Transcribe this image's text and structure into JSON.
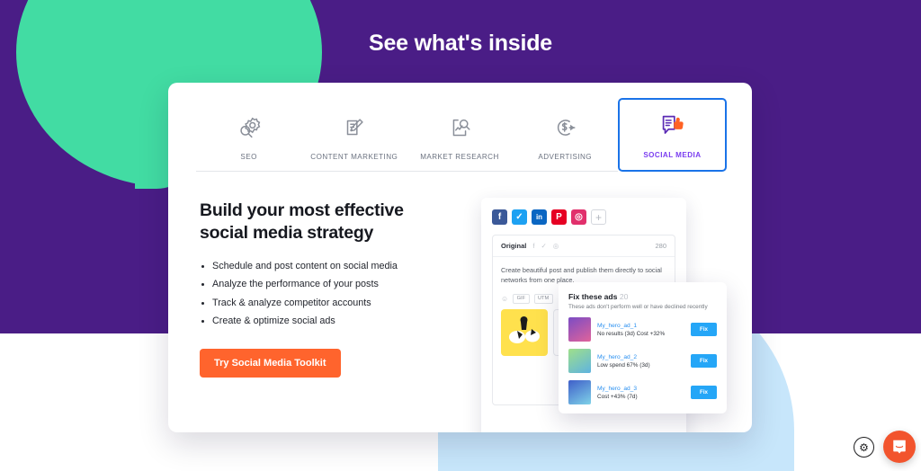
{
  "page": {
    "title": "See what's inside",
    "bg_purple": "#4a1d86",
    "bg_green": "#42dca3",
    "bg_blue": "#c7e6fb"
  },
  "tabs": [
    {
      "label": "SEO",
      "icon": "seo-magnifier-gear-icon",
      "active": false
    },
    {
      "label": "CONTENT MARKETING",
      "icon": "document-pencil-icon",
      "active": false
    },
    {
      "label": "MARKET RESEARCH",
      "icon": "report-magnifier-icon",
      "active": false
    },
    {
      "label": "ADVERTISING",
      "icon": "dollar-cursor-icon",
      "active": false
    },
    {
      "label": "SOCIAL MEDIA",
      "icon": "speech-bubble-thumbsup-icon",
      "active": true
    }
  ],
  "panel": {
    "headline": "Build your most effective social media strategy",
    "bullets": [
      "Schedule and post content on social media",
      "Analyze the performance of your posts",
      "Track & analyze competitor accounts",
      "Create & optimize social ads"
    ],
    "cta_label": "Try Social Media Toolkit",
    "cta_color": "#ff642d"
  },
  "product_shot": {
    "social_networks": [
      {
        "name": "facebook",
        "glyph": "f"
      },
      {
        "name": "twitter",
        "glyph": "✓"
      },
      {
        "name": "linkedin",
        "glyph": "in"
      },
      {
        "name": "pinterest",
        "glyph": "P"
      },
      {
        "name": "instagram",
        "glyph": "◎"
      },
      {
        "name": "add-network",
        "glyph": "+"
      }
    ],
    "post_editor": {
      "tab_label": "Original",
      "char_count": "280",
      "body_text": "Create beautiful post and publish them directly to social networks from one place.",
      "tools": [
        "GIF",
        "UTM"
      ],
      "emoji_icon": "☺"
    }
  },
  "fix_ads": {
    "title": "Fix these ads",
    "count": "20",
    "subtitle": "These ads don't perform well or have declined recently",
    "fix_label": "Fix",
    "rows": [
      {
        "name": "My_hero_ad_1",
        "stat": "No results (3d)  Cost +32%"
      },
      {
        "name": "My_hero_ad_2",
        "stat": "Low spend 67% (3d)"
      },
      {
        "name": "My_hero_ad_3",
        "stat": "Cost +43% (7d)"
      }
    ]
  },
  "widgets": {
    "settings_icon": "gear-icon",
    "chat_icon": "intercom-chat-icon",
    "chat_color": "#f2542d"
  }
}
